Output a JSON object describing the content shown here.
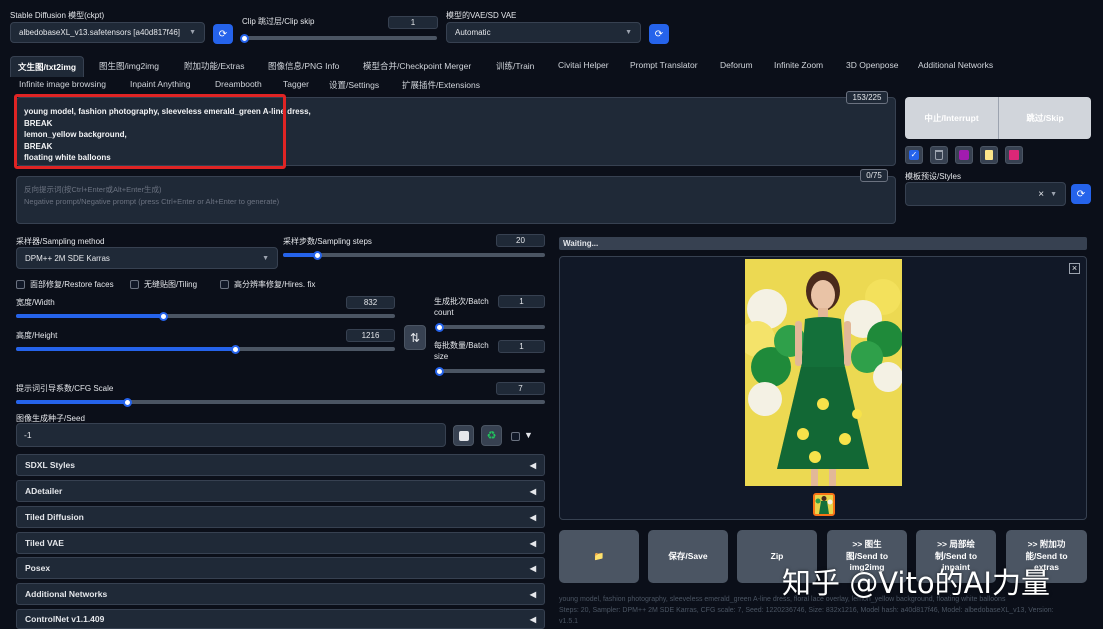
{
  "top": {
    "ckpt_label": "Stable Diffusion 模型(ckpt)",
    "ckpt_value": "albedobaseXL_v13.safetensors [a40d817f46]",
    "clip_label": "Clip 跳过层/Clip skip",
    "clip_value": "1",
    "vae_label": "模型的VAE/SD VAE",
    "vae_value": "Automatic",
    "refresh_glyph": "⟳"
  },
  "tabs_row1": [
    "文生图/txt2img",
    "图生图/img2img",
    "附加功能/Extras",
    "图像信息/PNG Info",
    "模型合并/Checkpoint Merger",
    "训练/Train",
    "Civitai Helper",
    "Prompt Translator",
    "Deforum",
    "Infinite Zoom",
    "3D Openpose",
    "Additional Networks"
  ],
  "tabs_row2": [
    "Infinite image browsing",
    "Inpaint Anything",
    "Dreambooth",
    "Tagger",
    "设置/Settings",
    "扩展插件/Extensions"
  ],
  "prompt": {
    "text_lines": [
      "young model, fashion photography, sleeveless emerald_green A-line dress,",
      "BREAK",
      "lemon_yellow background,",
      "BREAK",
      "floating white balloons"
    ],
    "token_count": "153/225",
    "neg_placeholder_line1": "反向提示词(按Ctrl+Enter或Alt+Enter生成)",
    "neg_placeholder_line2": "Negative prompt/Negative prompt (press Ctrl+Enter or Alt+Enter to generate)",
    "neg_token_count": "0/75"
  },
  "actions": {
    "interrupt": "中止/Interrupt",
    "skip": "跳过/Skip",
    "styles_label": "模板预设/Styles",
    "clear_glyph": "×"
  },
  "params": {
    "sampler_label": "采样器/Sampling method",
    "sampler_value": "DPM++ 2M SDE Karras",
    "steps_label": "采样步数/Sampling steps",
    "steps_value": "20",
    "steps_fraction": 0.13,
    "restore_faces": "面部修复/Restore faces",
    "tiling": "无缝贴图/Tiling",
    "hires": "高分辨率修复/Hires. fix",
    "width_label": "宽度/Width",
    "width_value": "832",
    "width_fraction": 0.39,
    "height_label": "高度/Height",
    "height_value": "1216",
    "height_fraction": 0.58,
    "batch_count_label_1": "生成批次/Batch",
    "batch_count_label_2": "count",
    "batch_count_value": "1",
    "batch_size_label_1": "每批数量/Batch",
    "batch_size_label_2": "size",
    "batch_size_value": "1",
    "cfg_label": "提示词引导系数/CFG Scale",
    "cfg_value": "7",
    "cfg_fraction": 0.21,
    "seed_label": "图像生成种子/Seed",
    "seed_value": "-1",
    "swap_glyph": "⇅"
  },
  "accordions": [
    "SDXL Styles",
    "ADetailer",
    "Tiled Diffusion",
    "Tiled VAE",
    "Posex",
    "Additional Networks",
    "ControlNet v1.1.409"
  ],
  "output": {
    "status": "Waiting...",
    "close_glyph": "×",
    "buttons": {
      "folder": "📁",
      "save": "保存/Save",
      "zip": "Zip",
      "send_img2img_1": ">> 图生",
      "send_img2img_2": "图/Send to",
      "send_img2img_3": "img2img",
      "send_inpaint_1": ">> 局部绘",
      "send_inpaint_2": "制/Send to",
      "send_inpaint_3": "inpaint",
      "send_extras_1": ">> 附加功",
      "send_extras_2": "能/Send to",
      "send_extras_3": "extras"
    },
    "info_line1": "young model, fashion photography, sleeveless emerald_green A-line dress, floral lace overlay, lemon_yellow background, floating white balloons",
    "info_line2": "Steps: 20, Sampler: DPM++ 2M SDE Karras, CFG scale: 7, Seed: 1220236746, Size: 832x1216, Model hash: a40d817f46, Model: albedobaseXL_v13, Version:",
    "info_line3": "v1.5.1"
  },
  "watermark": "知乎 @Vito的AI力量",
  "colors": {
    "accent": "#2563eb",
    "highlight_box": "#e02424",
    "background": "#0b0f19",
    "panel": "#1f2937"
  }
}
